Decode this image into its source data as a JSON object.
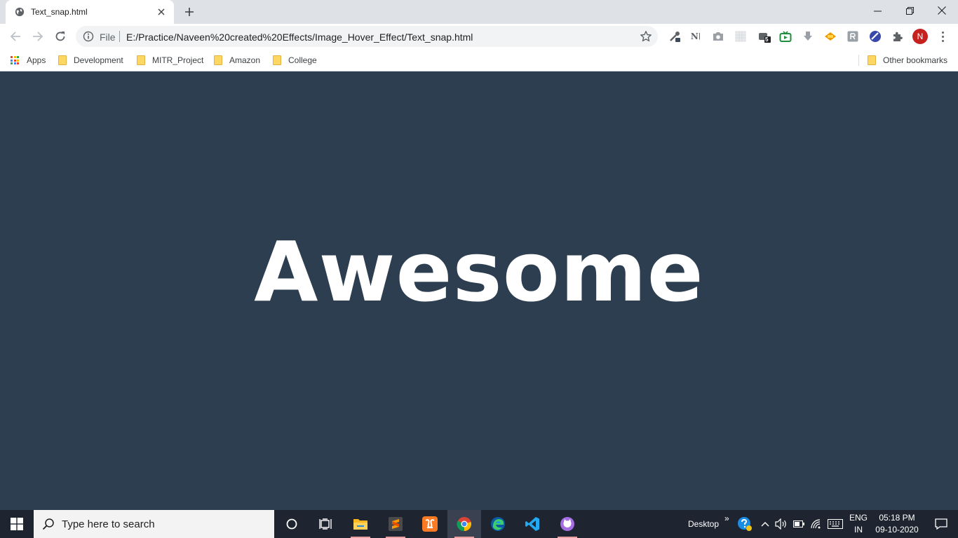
{
  "browser": {
    "tab": {
      "title": "Text_snap.html"
    },
    "address": {
      "scheme_label": "File",
      "url": "E:/Practice/Naveen%20created%20Effects/Image_Hover_Effect/Text_snap.html"
    },
    "extensions": {
      "notion_label": "N",
      "badge_count": "5"
    },
    "profile_initial": "N",
    "bookmarks": {
      "apps_label": "Apps",
      "items": [
        "Development",
        "MITR_Project",
        "Amazon",
        "College"
      ],
      "other_label": "Other bookmarks"
    }
  },
  "page": {
    "heading": "Awesome"
  },
  "taskbar": {
    "search_placeholder": "Type here to search",
    "desktop_label": "Desktop",
    "language": {
      "line1": "ENG",
      "line2": "IN"
    },
    "clock": {
      "time": "05:18 PM",
      "date": "09-10-2020"
    }
  },
  "colors": {
    "page_background": "#2d3e50",
    "heading_color": "#ffffff",
    "profile_avatar": "#c5221f",
    "taskbar": "#1f2530"
  }
}
